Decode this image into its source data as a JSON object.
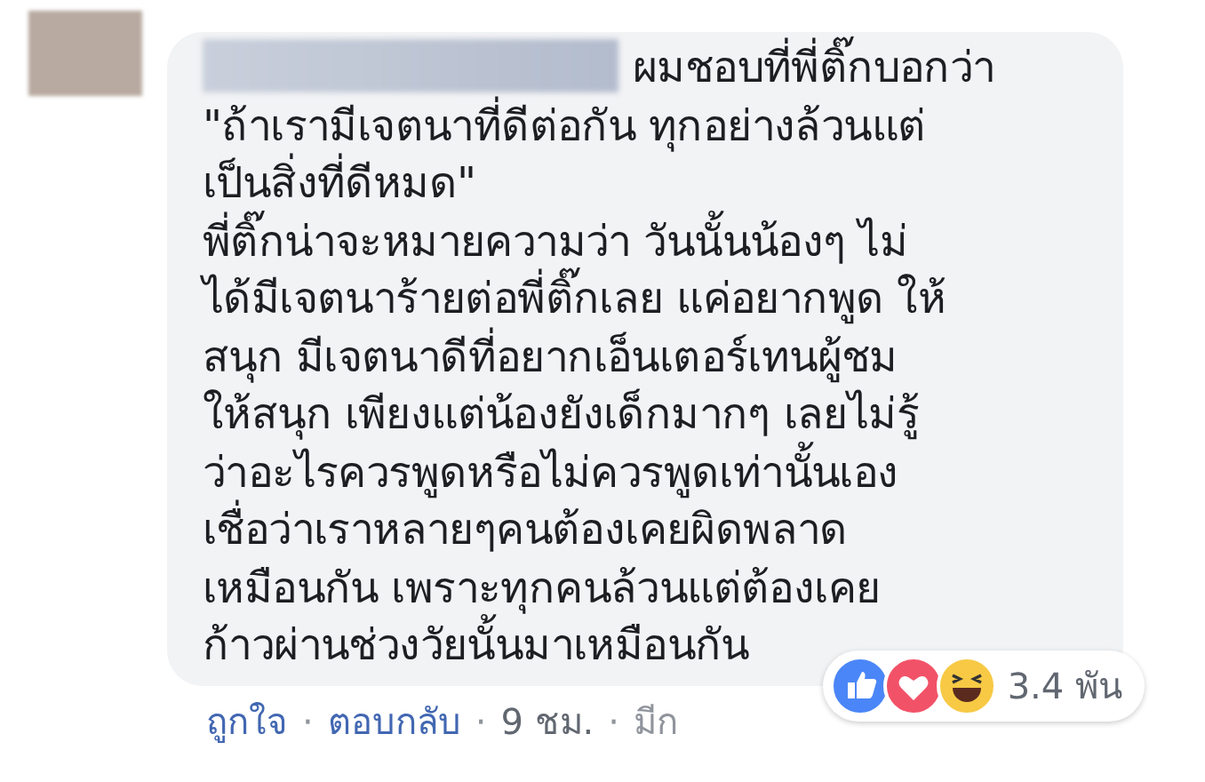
{
  "comment": {
    "lines": [
      "ผมชอบที่พี่ติ๊กบอกว่า",
      "\"ถ้าเรามีเจตนาที่ดีต่อกัน ทุกอย่างล้วนแต่",
      "เป็นสิ่งที่ดีหมด\"",
      "พี่ติ๊กน่าจะหมายความว่า วันนั้นน้องๆ ไม่",
      "ได้มีเจตนาร้ายต่อพี่ติ๊กเลย แค่อยากพูด ให้",
      "สนุก มีเจตนาดีที่อยากเอ็นเตอร์เทนผู้ชม",
      "ให้สนุก เพียงแต่น้องยังเด็กมากๆ เลยไม่รู้",
      "ว่าอะไรควรพูดหรือไม่ควรพูดเท่านั้นเอง",
      "เชื่อว่าเราหลายๆคนต้องเคยผิดพลาด",
      "เหมือนกัน เพราะทุกคนล้วนแต่ต้องเคย",
      "ก้าวผ่านช่วงวัยนั้นมาเหมือนกัน"
    ],
    "reactions": {
      "count": "3.4 พัน"
    },
    "separator": "·",
    "actions": [
      {
        "text": "ถูกใจ",
        "kind": "link"
      },
      {
        "text": "ตอบกลับ",
        "kind": "link"
      },
      {
        "text": "9 ชม.",
        "kind": "time"
      },
      {
        "text": "มีก",
        "kind": "meta"
      }
    ]
  }
}
